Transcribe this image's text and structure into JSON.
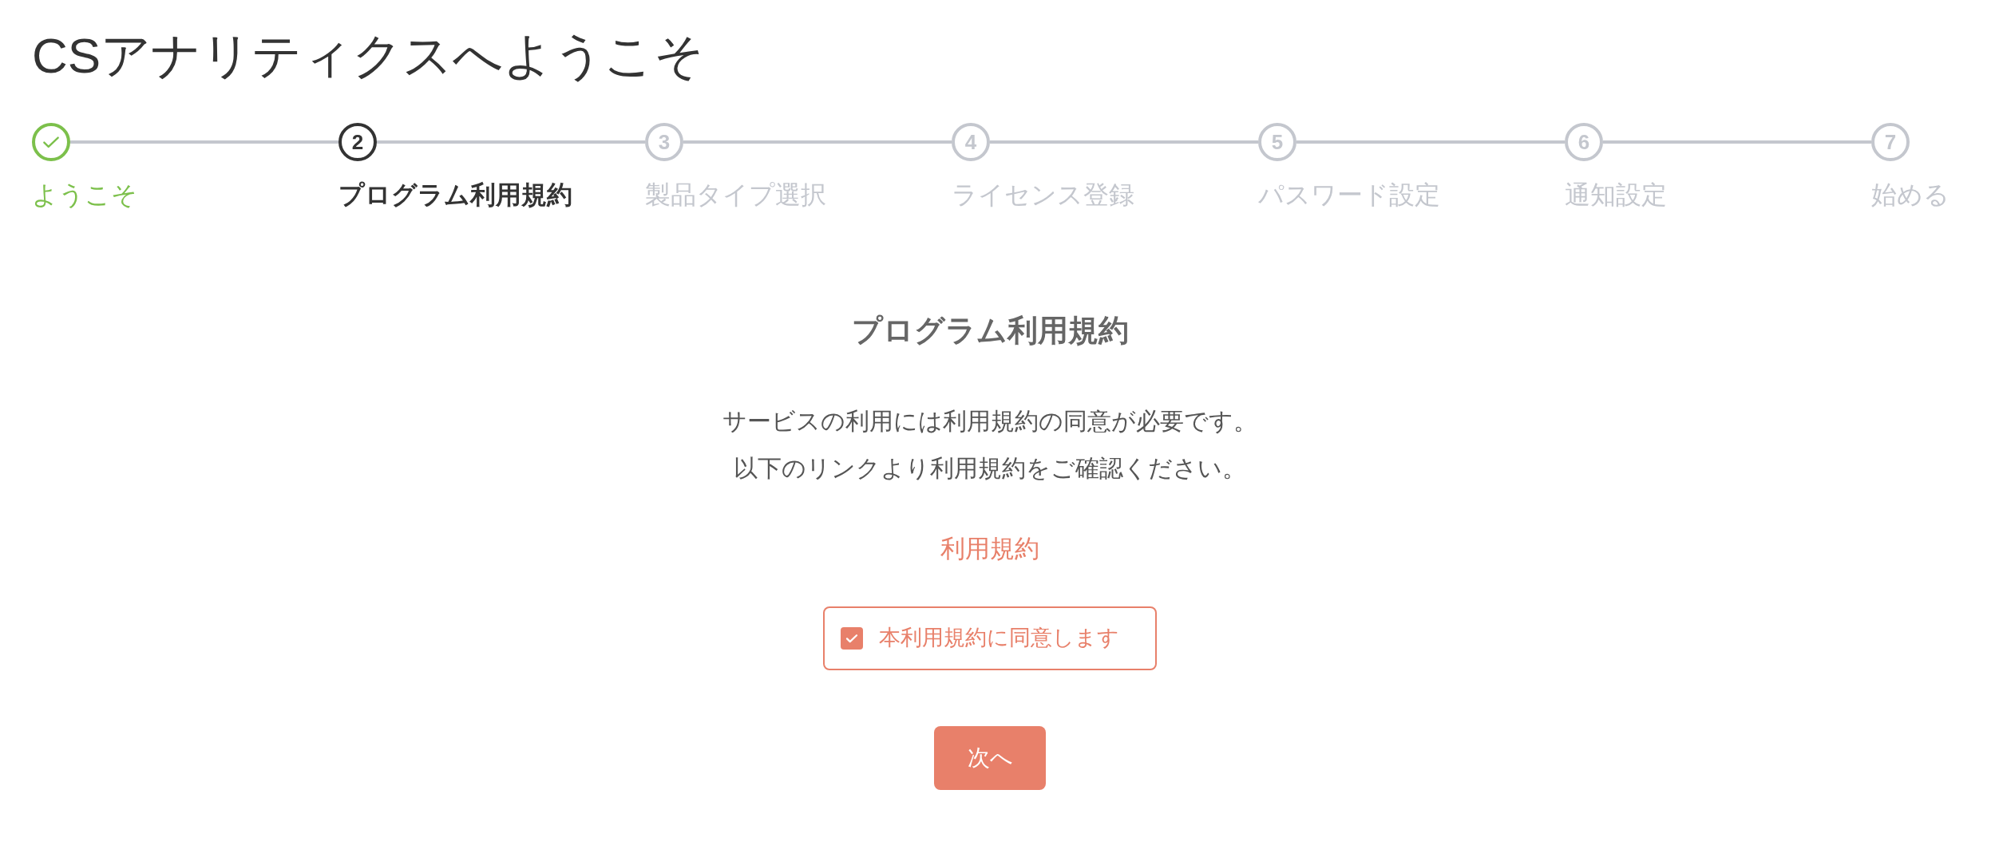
{
  "title": "CSアナリティクスへようこそ",
  "steps": [
    {
      "label": "ようこそ",
      "completed": true,
      "selected": false
    },
    {
      "number": "2",
      "label": "プログラム利用規約",
      "completed": false,
      "selected": true
    },
    {
      "number": "3",
      "label": "製品タイプ選択",
      "completed": false,
      "selected": false
    },
    {
      "number": "4",
      "label": "ライセンス登録",
      "completed": false,
      "selected": false
    },
    {
      "number": "5",
      "label": "パスワード設定",
      "completed": false,
      "selected": false
    },
    {
      "number": "6",
      "label": "通知設定",
      "completed": false,
      "selected": false
    },
    {
      "number": "7",
      "label": "始める",
      "completed": false,
      "selected": false
    }
  ],
  "section": {
    "heading": "プログラム利用規約",
    "message": [
      "サービスの利用には利用規約の同意が必要です。",
      "以下のリンクより利用規約をご確認ください。"
    ],
    "link": "利用規約",
    "agree": {
      "label": "本利用規約に同意します",
      "checked": true
    },
    "next_button": "次へ"
  }
}
